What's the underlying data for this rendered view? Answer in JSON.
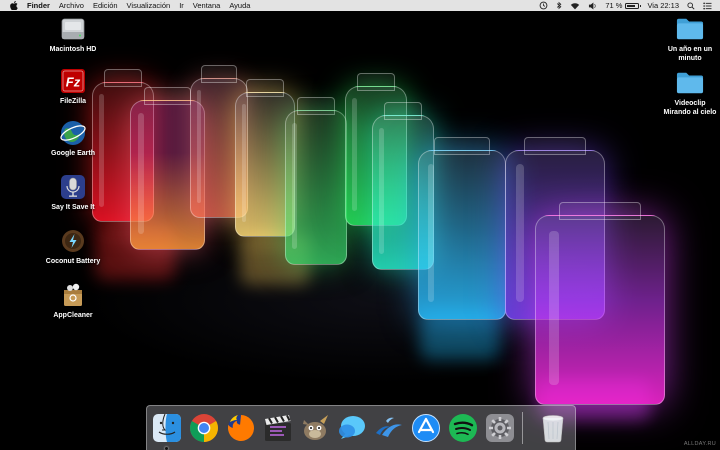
{
  "menubar": {
    "app_name": "Finder",
    "items": [
      "Archivo",
      "Edición",
      "Visualización",
      "Ir",
      "Ventana",
      "Ayuda"
    ],
    "battery_percent": "71 %",
    "battery_level": 0.71,
    "clock": "Via 22:13"
  },
  "desktop_left": [
    {
      "label": "Macintosh HD",
      "icon": "hard-drive-icon"
    },
    {
      "label": "FileZilla",
      "icon": "filezilla-icon"
    },
    {
      "label": "Google Earth",
      "icon": "google-earth-icon"
    },
    {
      "label": "Say It Save It",
      "icon": "microphone-icon"
    },
    {
      "label": "Coconut Battery",
      "icon": "coconut-battery-icon"
    },
    {
      "label": "AppCleaner",
      "icon": "appcleaner-icon"
    }
  ],
  "desktop_right": [
    {
      "label": "Un año en un\nminuto",
      "icon": "folder-icon"
    },
    {
      "label": "Videoclip\nMirando al cielo",
      "icon": "folder-icon"
    }
  ],
  "dock": [
    {
      "name": "finder",
      "icon": "finder-icon",
      "running": true
    },
    {
      "name": "chrome",
      "icon": "chrome-icon",
      "running": false
    },
    {
      "name": "firefox",
      "icon": "firefox-icon",
      "running": false
    },
    {
      "name": "final-cut-pro",
      "icon": "clapperboard-icon",
      "running": false
    },
    {
      "name": "gimp",
      "icon": "gimp-icon",
      "running": false
    },
    {
      "name": "messages",
      "icon": "messages-icon",
      "running": false
    },
    {
      "name": "openoffice",
      "icon": "openoffice-icon",
      "running": false
    },
    {
      "name": "app-store",
      "icon": "app-store-icon",
      "running": false
    },
    {
      "name": "spotify",
      "icon": "spotify-icon",
      "running": false
    },
    {
      "name": "system-preferences",
      "icon": "gear-icon",
      "running": false
    },
    {
      "name": "trash",
      "icon": "trash-icon",
      "running": false
    }
  ],
  "watermark": "ALLDAY.RU",
  "colors": {
    "menubar": "#ececec",
    "folder": "#5fb9ec",
    "spotify": "#1db954",
    "filezilla": "#bf0000"
  }
}
